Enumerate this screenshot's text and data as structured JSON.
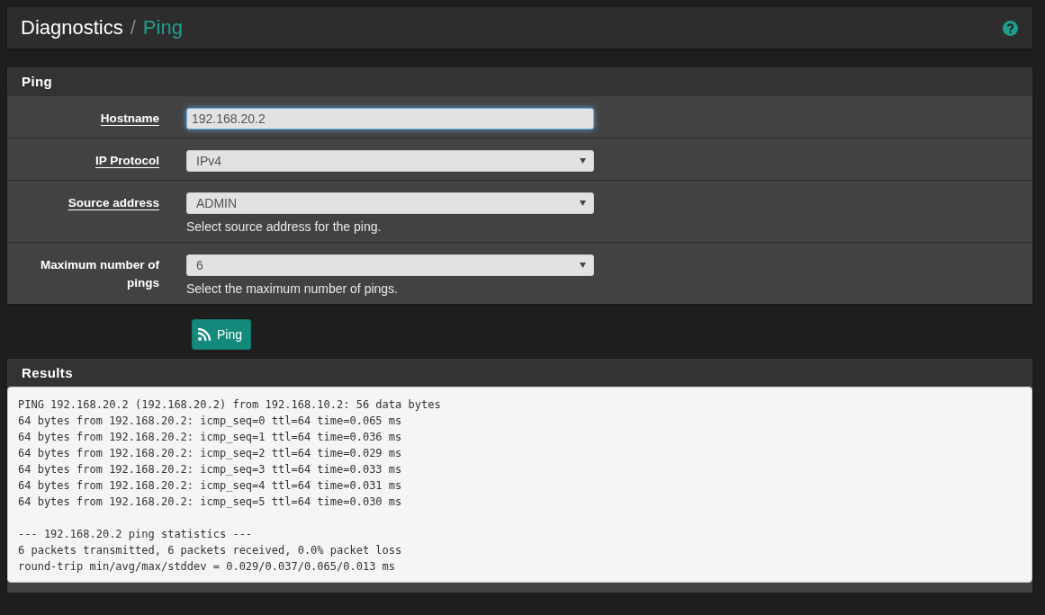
{
  "breadcrumb": {
    "parent": "Diagnostics",
    "separator": "/",
    "current": "Ping"
  },
  "form_panel": {
    "title": "Ping",
    "fields": [
      {
        "kind": "input",
        "label": "Hostname",
        "value": "192.168.20.2",
        "focused": true,
        "underlined": true
      },
      {
        "kind": "select",
        "label": "IP Protocol",
        "value": "IPv4",
        "focused": false,
        "underlined": true
      },
      {
        "kind": "select",
        "label": "Source address",
        "value": "ADMIN",
        "help": "Select source address for the ping.",
        "focused": false,
        "underlined": true
      },
      {
        "kind": "select",
        "label": "Maximum number of pings",
        "value": "6",
        "help": "Select the maximum number of pings.",
        "focused": false,
        "underlined": false
      }
    ]
  },
  "ping_button": {
    "label": "Ping"
  },
  "results_panel": {
    "title": "Results",
    "output": "PING 192.168.20.2 (192.168.20.2) from 192.168.10.2: 56 data bytes\n64 bytes from 192.168.20.2: icmp_seq=0 ttl=64 time=0.065 ms\n64 bytes from 192.168.20.2: icmp_seq=1 ttl=64 time=0.036 ms\n64 bytes from 192.168.20.2: icmp_seq=2 ttl=64 time=0.029 ms\n64 bytes from 192.168.20.2: icmp_seq=3 ttl=64 time=0.033 ms\n64 bytes from 192.168.20.2: icmp_seq=4 ttl=64 time=0.031 ms\n64 bytes from 192.168.20.2: icmp_seq=5 ttl=64 time=0.030 ms\n\n--- 192.168.20.2 ping statistics ---\n6 packets transmitted, 6 packets received, 0.0% packet loss\nround-trip min/avg/max/stddev = 0.029/0.037/0.065/0.013 ms"
  }
}
